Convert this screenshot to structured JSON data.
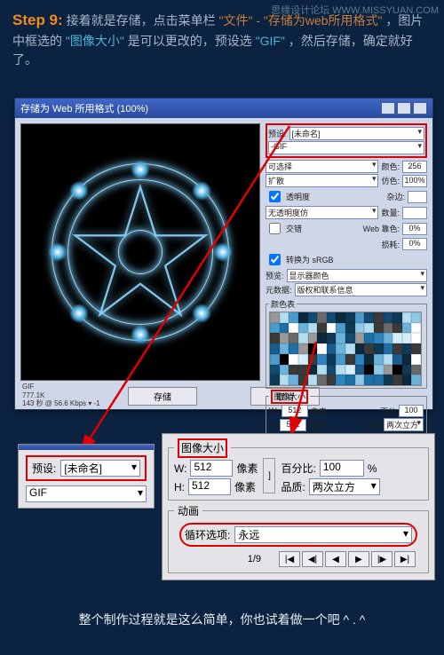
{
  "watermark": "思缘设计论坛 WWW.MISSYUAN.COM",
  "step": {
    "label": "Step 9:",
    "a": "接着就是存储，点击菜单栏",
    "b": "\"文件\"",
    "c": "-",
    "d": "\"存储为web所用格式\"",
    "e": "，图片中框选的",
    "f": "\"图像大小\"",
    "g": "是可以更改的，预设选",
    "h": "\"GIF\"",
    "i": "，然后存储，确定就好了。"
  },
  "app": {
    "title": "存储为 Web 所用格式 (100%)",
    "info": {
      "format": "GIF",
      "size": "777.1K",
      "speed": "143 秒 @ 56.6 Kbps ▾ -1"
    },
    "footer": {
      "save": "存储",
      "cancel": "取消"
    }
  },
  "side": {
    "preset_label": "预设:",
    "preset_value": "[未命名]",
    "format": "-GIF",
    "rows": {
      "select_label": "可选择",
      "loss": "损耗:",
      "loss_v": "0",
      "color_label": "颜色:",
      "color_v": "256",
      "diffusion": "扩散",
      "dither": "仿色:",
      "dither_v": "100%",
      "trans": "透明度",
      "matte": "杂边:",
      "no_trans_dith": "无透明度仿",
      "count": "数量:",
      "interlace": "交错",
      "web_shift": "Web 靠色:",
      "web_v": "0%",
      "lum": "损耗:",
      "lum_v": "0%"
    },
    "convert_srgb": "转换为 sRGB",
    "preview_menu": "显示器颜色",
    "meta": "元数据:",
    "meta_v": "版权和联系信息",
    "color_table": "颜色表",
    "image_size": {
      "title": "图像大小",
      "w": "W:",
      "h": "H:",
      "wv": "512",
      "hv": "512",
      "px": "像素",
      "pct": "百分",
      "pct_v": "100",
      "q": "品质",
      "qv": "两次立方"
    },
    "anim": {
      "title": "动画",
      "loop": "循环选项:",
      "loop_v": "永远",
      "frame": "1/-",
      "controls": [
        "|◀",
        "◀◀",
        "◀",
        "▶",
        "▶▶",
        "▶|"
      ]
    }
  },
  "zoom_left": {
    "preset": "预设:",
    "preset_v": "[未命名]",
    "format": "GIF"
  },
  "zoom_right": {
    "img": {
      "title": "图像大小",
      "w": "W:",
      "wv": "512",
      "h": "H:",
      "hv": "512",
      "px": "像素",
      "pct": "百分比:",
      "pct_v": "100",
      "pct_s": "%",
      "q": "品质:",
      "qv": "两次立方"
    },
    "anim": {
      "title": "动画",
      "loop": "循环选项:",
      "loop_v": "永远",
      "frame": "1/9",
      "controls": [
        "|◀",
        "◀|",
        "◀",
        "▶",
        "|▶",
        "▶|"
      ]
    }
  },
  "conclusion": "整个制作过程就是这么简单，你也试着做一个吧 ^ . ^",
  "swatch_colors": [
    "#0b2a3e",
    "#0f3a56",
    "#134a70",
    "#1a5c8d",
    "#1f6ea6",
    "#2f85bf",
    "#4b9ccd",
    "#6cb3db",
    "#8ecae6",
    "#b3def0",
    "#d5eef9",
    "#ffffff",
    "#000000",
    "#3a3a3a",
    "#6a6a6a",
    "#9a9a9a"
  ]
}
